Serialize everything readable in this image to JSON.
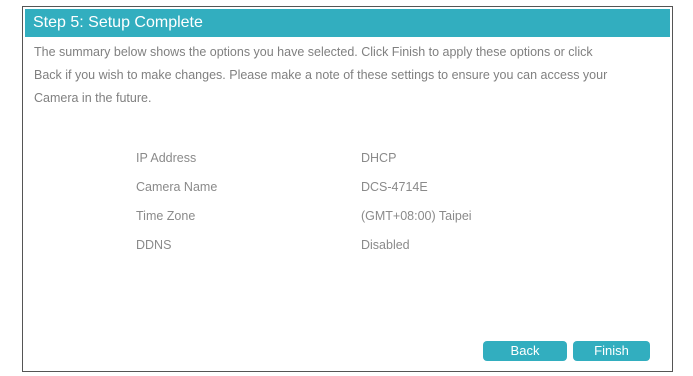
{
  "header": {
    "title": "Step 5: Setup Complete"
  },
  "description": {
    "line1": "The summary below shows the options you have selected. Click Finish to apply these options or click",
    "line2": "Back if you wish to make changes. Please make a note of these settings to ensure you can access your",
    "line3": "Camera in the future."
  },
  "summary": [
    {
      "label": "IP Address",
      "value": "DHCP"
    },
    {
      "label": "Camera Name",
      "value": "DCS-4714E"
    },
    {
      "label": "Time Zone",
      "value": "(GMT+08:00) Taipei"
    },
    {
      "label": "DDNS",
      "value": "Disabled"
    }
  ],
  "buttons": {
    "back": "Back",
    "finish": "Finish"
  },
  "colors": {
    "accent": "#32aebf",
    "text": "#808080"
  }
}
